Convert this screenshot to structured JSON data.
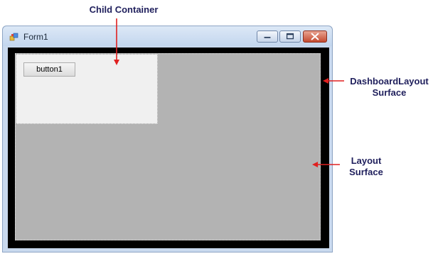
{
  "window": {
    "title": "Form1",
    "controls": {
      "minimize_icon": "minimize-icon",
      "maximize_icon": "maximize-icon",
      "close_icon": "close-icon"
    }
  },
  "child_container": {
    "button_label": "button1"
  },
  "annotations": {
    "child_container": "Child Container",
    "dashboard_layout_surface": [
      "DashboardLayout",
      "Surface"
    ],
    "layout_surface": [
      "Layout",
      "Surface"
    ]
  },
  "colors": {
    "arrow": "#e02020",
    "label": "#1f1f5c",
    "layout_surface": "#b3b3b3",
    "dashboard_surface": "#000000",
    "child_container": "#f0f0f0"
  }
}
